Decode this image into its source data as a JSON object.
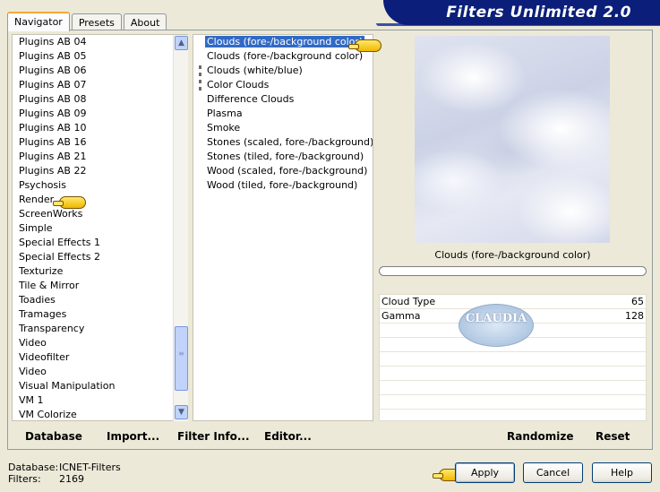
{
  "tabs": [
    {
      "label": "Navigator"
    },
    {
      "label": "Presets"
    },
    {
      "label": "About"
    }
  ],
  "banner": {
    "title": "Filters Unlimited 2.0"
  },
  "navigator": {
    "items": [
      "Plugins AB 04",
      "Plugins AB 05",
      "Plugins AB 06",
      "Plugins AB 07",
      "Plugins AB 08",
      "Plugins AB 09",
      "Plugins AB 10",
      "Plugins AB 16",
      "Plugins AB 21",
      "Plugins AB 22",
      "Psychosis",
      "Render",
      "ScreenWorks",
      "Simple",
      "Special Effects 1",
      "Special Effects 2",
      "Texturize",
      "Tile & Mirror",
      "Toadies",
      "Tramages",
      "Transparency",
      "Video",
      "Videofilter",
      "Video",
      "Visual Manipulation",
      "VM 1",
      "VM Colorize"
    ]
  },
  "filters": {
    "items": [
      "Clouds (fore-/background color)",
      "Clouds (fore-/background color)",
      "Clouds (white/blue)",
      "Color Clouds",
      "Difference Clouds",
      "Plasma",
      "Smoke",
      "Stones (scaled, fore-/background)",
      "Stones (tiled, fore-/background)",
      "Wood (scaled, fore-/background)",
      "Wood (tiled, fore-/background)"
    ]
  },
  "preview": {
    "filter_name": "Clouds (fore-/background color)"
  },
  "params": [
    {
      "name": "Cloud Type",
      "value": "65"
    },
    {
      "name": "Gamma",
      "value": "128"
    }
  ],
  "watermark": {
    "text": "CLAUDIA"
  },
  "panel_buttons": {
    "database": "Database",
    "import": "Import...",
    "filter_info": "Filter Info...",
    "editor": "Editor...",
    "randomize": "Randomize",
    "reset": "Reset"
  },
  "status": {
    "database_label": "Database:",
    "database_value": "ICNET-Filters",
    "filters_label": "Filters:",
    "filters_value": "2169"
  },
  "dialog_buttons": {
    "apply": "Apply",
    "cancel": "Cancel",
    "help": "Help"
  }
}
